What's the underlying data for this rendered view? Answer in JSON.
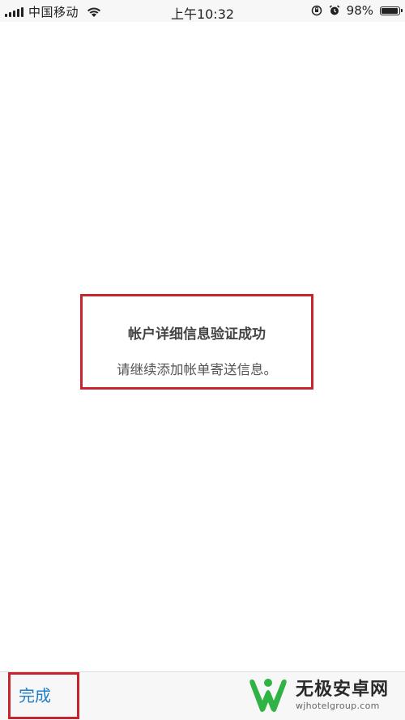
{
  "status_bar": {
    "carrier": "中国移动",
    "time": "上午10:32",
    "battery": "98%",
    "battery_level": 0.98,
    "icons": [
      "signal-icon",
      "wifi-icon",
      "rotation-lock-icon",
      "alarm-icon",
      "battery-icon"
    ]
  },
  "message": {
    "title": "帐户详细信息验证成功",
    "subtitle": "请继续添加帐单寄送信息。"
  },
  "bottom_bar": {
    "done_label": "完成"
  },
  "watermark": {
    "name": "无极安卓网",
    "url": "wjhotelgroup.com"
  },
  "colors": {
    "highlight_border": "#c9242d",
    "link_blue": "#1e7fc8",
    "logo_green": "#2fb344"
  }
}
